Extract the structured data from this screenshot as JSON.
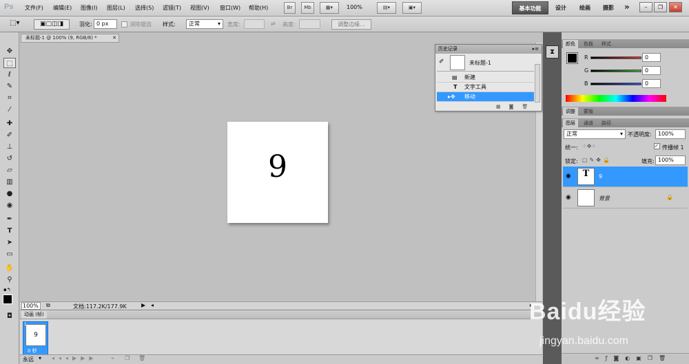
{
  "app": {
    "logo": "Ps"
  },
  "menu": [
    "文件(F)",
    "编辑(E)",
    "图像(I)",
    "图层(L)",
    "选择(S)",
    "滤镜(T)",
    "视图(V)",
    "窗口(W)",
    "帮助(H)"
  ],
  "toolbar_top": {
    "bridge": "Br",
    "minibridge": "Mb",
    "zoom": "100%"
  },
  "workspaces": {
    "active": "基本功能",
    "others": [
      "设计",
      "绘画",
      "摄影"
    ],
    "more": "»"
  },
  "window_buttons": {
    "minimize": "–",
    "restore": "❐",
    "close": "✕"
  },
  "options": {
    "feather_label": "羽化:",
    "feather_value": "0 px",
    "antialias": "消除锯齿",
    "style_label": "样式:",
    "style_value": "正常",
    "width_label": "宽度:",
    "height_label": "高度:",
    "refine": "调整边缘..."
  },
  "document": {
    "tab_title": "未标题-1 @ 100% (9, RGB/8) *",
    "digit": "9"
  },
  "status": {
    "zoom": "100%",
    "doc_info": "文档:117.2K/177.9K"
  },
  "animation": {
    "tab": "动画 (帧)",
    "frame_number": "1",
    "frame_digit": "9",
    "frame_delay": "0 秒",
    "loop": "永远"
  },
  "history": {
    "title": "历史记录",
    "snapshot": "未标题-1",
    "items": [
      "新建",
      "文字工具",
      "移动"
    ]
  },
  "color_panel": {
    "tabs": [
      "颜色",
      "色板",
      "样式"
    ],
    "channels": [
      {
        "label": "R",
        "value": "0"
      },
      {
        "label": "G",
        "value": "0"
      },
      {
        "label": "B",
        "value": "0"
      }
    ],
    "colors": {
      "red": "#e03030",
      "green": "#3aa83a",
      "blue": "#3050e0"
    }
  },
  "adjust_panel": {
    "tabs": [
      "调整",
      "蒙版"
    ]
  },
  "layers_panel": {
    "tabs": [
      "图层",
      "通道",
      "路径"
    ],
    "blend": "正常",
    "opacity_label": "不透明度:",
    "opacity": "100%",
    "unify_label": "统一:",
    "propagate": "传播帧 1",
    "lock_label": "锁定:",
    "fill_label": "填充:",
    "fill": "100%",
    "layers": [
      {
        "name": "9",
        "type": "T"
      },
      {
        "name": "背景",
        "type": ""
      }
    ]
  },
  "watermark": {
    "main": "Baidu经验",
    "sub": "jingyan.baidu.com"
  }
}
